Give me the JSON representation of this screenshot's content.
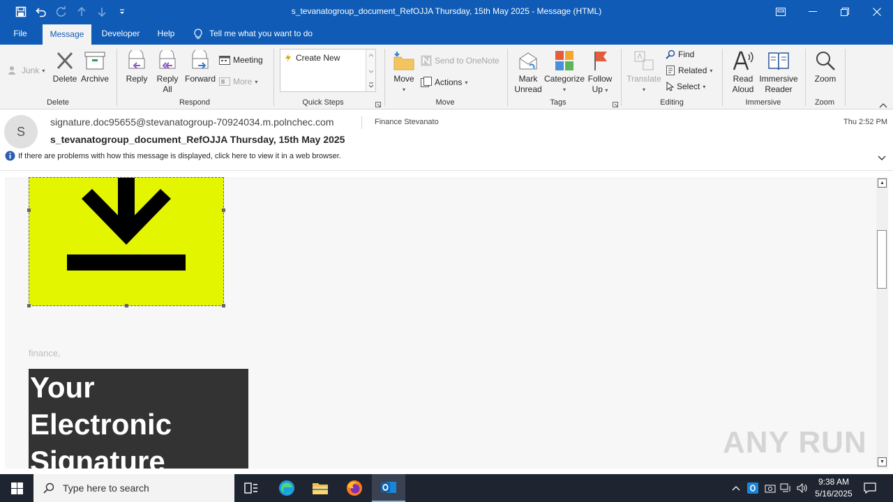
{
  "window": {
    "title": "s_tevanatogroup_document_RefOJJA Thursday, 15th May 2025  -  Message (HTML)"
  },
  "menu": {
    "tabs": [
      "File",
      "Message",
      "Developer",
      "Help"
    ],
    "active_tab": "Message",
    "tell_me": "Tell me what you want to do"
  },
  "ribbon": {
    "groups": {
      "delete": "Delete",
      "respond": "Respond",
      "quick_steps": "Quick Steps",
      "move": "Move",
      "tags": "Tags",
      "editing": "Editing",
      "immersive": "Immersive",
      "zoom": "Zoom"
    },
    "junk": "Junk",
    "delete": "Delete",
    "archive": "Archive",
    "reply": "Reply",
    "reply_all_1": "Reply",
    "reply_all_2": "All",
    "forward": "Forward",
    "meeting": "Meeting",
    "more": "More",
    "create_new": "Create New",
    "move": "Move",
    "send_to_onenote": "Send to OneNote",
    "actions": "Actions",
    "mark_unread_1": "Mark",
    "mark_unread_2": "Unread",
    "categorize": "Categorize",
    "follow_up_1": "Follow",
    "follow_up_2": "Up",
    "translate": "Translate",
    "find": "Find",
    "related": "Related",
    "select": "Select",
    "read_aloud_1": "Read",
    "read_aloud_2": "Aloud",
    "immersive_reader_1": "Immersive",
    "immersive_reader_2": "Reader",
    "zoom": "Zoom"
  },
  "message": {
    "avatar_initial": "S",
    "from": "signature.doc95655@stevanatogroup-70924034.m.polnchec.com",
    "to": "Finance Stevanato",
    "date": "Thu 2:52 PM",
    "subject": "s_tevanatogroup_document_RefOJJA Thursday, 15th May 2025",
    "info_bar": "If there are problems with how this message is displayed, click here to view it in a web browser."
  },
  "body": {
    "greeting": "finance,",
    "banner_lines": [
      "Your",
      "Electronic",
      "Signature"
    ],
    "watermark": "ANY RUN"
  },
  "taskbar": {
    "search_placeholder": "Type here to search",
    "time": "9:38 AM",
    "date": "5/16/2025"
  },
  "colors": {
    "accent": "#0f5bb5",
    "download_image_bg": "#e3f600",
    "banner_bg": "#333333"
  }
}
